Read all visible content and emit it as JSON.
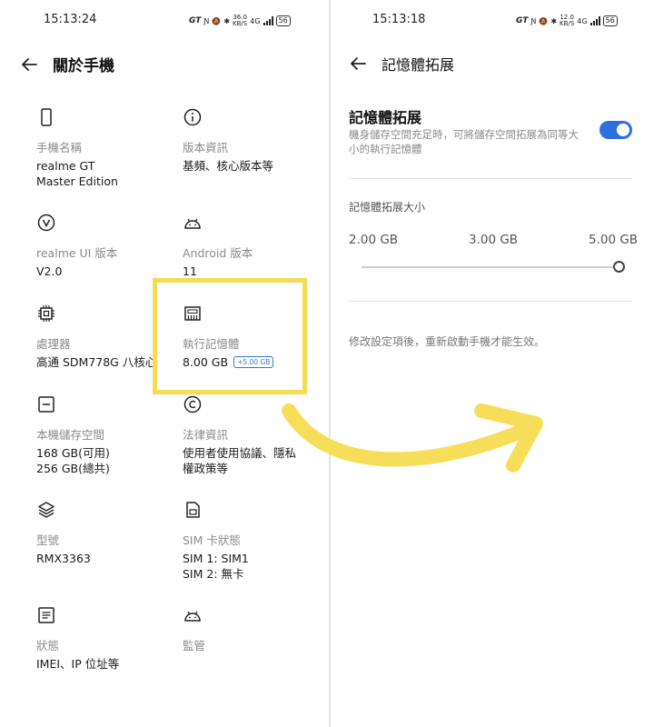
{
  "left": {
    "status": {
      "time": "15:13:24",
      "gt": "GT",
      "speed_value": "36.0",
      "speed_unit": "KB/S",
      "network": "4G",
      "battery": "56"
    },
    "header": {
      "title": "關於手機"
    },
    "items": [
      {
        "label": "手機名稱",
        "value": "realme GT Master Edition",
        "icon": "phone-icon"
      },
      {
        "label": "版本資訊",
        "value": "基頻、核心版本等",
        "icon": "info-icon"
      },
      {
        "label": "realme UI 版本",
        "value": "V2.0",
        "icon": "realme-v-icon"
      },
      {
        "label": "Android 版本",
        "value": "11",
        "icon": "android-icon"
      },
      {
        "label": "處理器",
        "value": "高通 SDM778G 八核心",
        "icon": "processor-chip-icon"
      },
      {
        "label": "執行記憶體",
        "value": "8.00 GB",
        "badge": "+5.00 GB",
        "icon": "ram-icon"
      },
      {
        "label": "本機儲存空間",
        "value": "168 GB(可用)\n256 GB(總共)",
        "icon": "storage-icon"
      },
      {
        "label": "法律資訊",
        "value": "使用者使用協議、隱私權政策等",
        "icon": "copyright-icon"
      },
      {
        "label": "型號",
        "value": "RMX3363",
        "icon": "layers-icon"
      },
      {
        "label": "SIM 卡狀態",
        "value": "SIM 1: SIM1\nSIM 2: 無卡",
        "icon": "sim-card-icon"
      },
      {
        "label": "狀態",
        "value": "IMEI、IP 位址等",
        "icon": "document-icon"
      },
      {
        "label": "監管",
        "value": "",
        "icon": "android-icon"
      }
    ]
  },
  "right": {
    "status": {
      "time": "15:13:18",
      "gt": "GT",
      "speed_value": "12.0",
      "speed_unit": "KB/S",
      "network": "4G",
      "battery": "56"
    },
    "header": {
      "title": "記憶體拓展"
    },
    "switch": {
      "title": "記憶體拓展",
      "desc": "機身儲存空間充足時，可將儲存空間拓展為同等大小的執行記憶體",
      "on": true
    },
    "size": {
      "label": "記憶體拓展大小",
      "options": [
        "2.00 GB",
        "3.00 GB",
        "5.00 GB"
      ],
      "selected": "5.00 GB"
    },
    "note": "修改設定項後，重新啟動手機才能生效。"
  },
  "colors": {
    "accent": "#2e6fe0",
    "highlight": "#f4dc55",
    "arrow": "#f7de5a"
  }
}
